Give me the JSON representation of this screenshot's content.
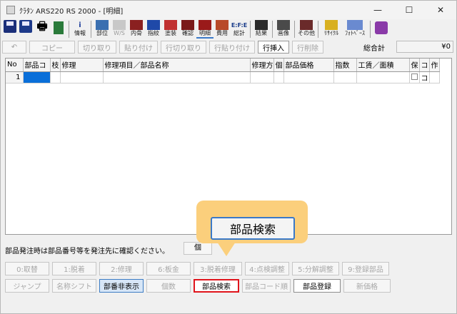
{
  "window": {
    "title": "ｸﾗﾀﾝ ARS220 RS 2000 - [明細]",
    "controls": [
      "—",
      "☐",
      "✕"
    ]
  },
  "toolbar_icons": [
    {
      "icon": "save-icon",
      "label": ""
    },
    {
      "icon": "save-as-icon",
      "label": ""
    },
    {
      "icon": "print-icon",
      "label": ""
    },
    {
      "icon": "exit-icon",
      "label": ""
    },
    {
      "icon": "info-icon",
      "label": "情報"
    },
    {
      "icon": "part-position-icon",
      "label": "部位"
    },
    {
      "icon": "ws-icon",
      "label": "W/S"
    },
    {
      "icon": "inner-bone-icon",
      "label": "内骨"
    },
    {
      "icon": "inspection-icon",
      "label": "指紋"
    },
    {
      "icon": "paint-icon",
      "label": "塗装"
    },
    {
      "icon": "confirm-icon",
      "label": "確認"
    },
    {
      "icon": "detail-icon",
      "label": "明細"
    },
    {
      "icon": "cost-icon",
      "label": "費用"
    },
    {
      "icon": "total-icon",
      "label": "総計"
    },
    {
      "icon": "result-icon",
      "label": "結果"
    },
    {
      "icon": "image-icon",
      "label": "画像"
    },
    {
      "icon": "other-icon",
      "label": "その他"
    },
    {
      "icon": "recycle-icon",
      "label": "ﾘｻｲｸﾙ"
    },
    {
      "icon": "photobase-icon",
      "label": "ﾌｫﾄﾍﾞｰｽ"
    },
    {
      "icon": "help-icon",
      "label": ""
    }
  ],
  "edit_bar": {
    "undo": "↶",
    "copy": "コピー",
    "cut": "切り取り",
    "paste": "貼り付け",
    "row_cut": "行切り取り",
    "row_paste": "行貼り付け",
    "row_insert": "行挿入",
    "row_delete": "行削除",
    "total_label": "総合計",
    "total_value": "¥0"
  },
  "grid": {
    "columns": [
      "No",
      "部品コ",
      "枝",
      "修理",
      "修理項目／部品名称",
      "修理方",
      "個",
      "部品価格",
      "指数",
      "工賃／面積",
      "保",
      "コ",
      "作"
    ],
    "rows": [
      {
        "no": "1",
        "code": "",
        "branch": "",
        "repair": "",
        "item": "",
        "method": "",
        "qty": "",
        "price": "",
        "index": "",
        "labor": "",
        "ho": "",
        "ko": "コ",
        "saku": ""
      }
    ]
  },
  "notice": "部品発注時は部品番号等を発注先に確認ください。",
  "partial_button": "個",
  "function_row1": [
    "0:取替",
    "1:脱着",
    "2:修理",
    "6:板金",
    "3:脱着修理",
    "4:点検調整",
    "5:分解調整",
    "9:登録部品"
  ],
  "function_row2": [
    "ジャンプ",
    "名称シフト",
    "部番非表示",
    "個数",
    "部品検索",
    "部品コード順",
    "部品登録",
    "新価格"
  ],
  "callout": {
    "label": "部品検索"
  }
}
